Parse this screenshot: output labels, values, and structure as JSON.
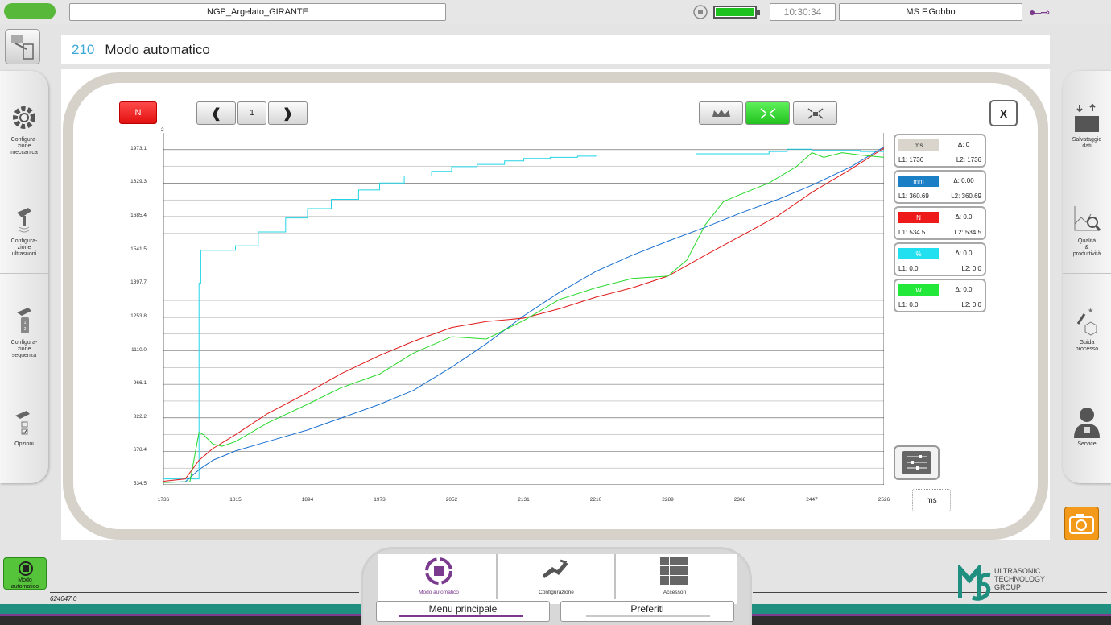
{
  "topbar": {
    "program_name": "NGP_Argelato_GIRANTE",
    "time": "10:30:34",
    "user": "MS F.Gobbo"
  },
  "header": {
    "number": "210",
    "title": "Modo automatico"
  },
  "left_nav": [
    {
      "label": "Configura-\nzione\nmeccanica",
      "icon": "gear-icon"
    },
    {
      "label": "Configura-\nzione\nultrasuoni",
      "icon": "sonotrode-icon"
    },
    {
      "label": "Configura-\nzione\nsequenza",
      "icon": "sequence-icon"
    },
    {
      "label": "Opzioni",
      "icon": "options-icon"
    }
  ],
  "right_nav": [
    {
      "label": "Salvataggio\ndati",
      "icon": "save-data-icon"
    },
    {
      "label": "Qualità\n&\nproduttività",
      "icon": "quality-icon"
    },
    {
      "label": "Guida\nprocesso",
      "icon": "process-guide-icon"
    },
    {
      "label": "Service",
      "icon": "service-person-icon"
    }
  ],
  "chart_controls": {
    "unit_button": "N",
    "page": "1",
    "close": "X"
  },
  "legend": [
    {
      "unit": "ms",
      "delta": "Δ: 0",
      "l1": "L1: 1736",
      "l2": "L2: 1736",
      "color": "#d9d4cc"
    },
    {
      "unit": "mm",
      "delta": "Δ: 0.00",
      "l1": "L1: 360.69",
      "l2": "L2: 360.69",
      "color": "#1a7fc4"
    },
    {
      "unit": "N",
      "delta": "Δ: 0.0",
      "l1": "L1: 534.5",
      "l2": "L2: 534.5",
      "color": "#ee1a1a"
    },
    {
      "unit": "%",
      "delta": "Δ: 0.0",
      "l1": "L1: 0.0",
      "l2": "L2: 0.0",
      "color": "#22e0f0"
    },
    {
      "unit": "W",
      "delta": "Δ: 0.0",
      "l1": "L1: 0.0",
      "l2": "L2: 0.0",
      "color": "#22e83a"
    }
  ],
  "x_unit": "ms",
  "chart_data": {
    "type": "line",
    "y_top_marker": "2",
    "yticks": [
      "1973.1",
      "1829.3",
      "1685.4",
      "1541.5",
      "1397.7",
      "1253.8",
      "1110.0",
      "966.1",
      "822.2",
      "678.4",
      "534.5"
    ],
    "xticks": [
      "1736",
      "1815",
      "1894",
      "1973",
      "2052",
      "2131",
      "2210",
      "2289",
      "2368",
      "2447",
      "2526"
    ],
    "xlim": [
      1736,
      2526
    ],
    "ylim": [
      534.5,
      2045
    ],
    "series": [
      {
        "name": "%",
        "color": "#22d4e6",
        "x": [
          1736,
          1760,
          1772,
          1775,
          1777,
          1780,
          1800,
          1815,
          1840,
          1870,
          1894,
          1920,
          1950,
          1973,
          2000,
          2030,
          2052,
          2080,
          2110,
          2131,
          2160,
          2190,
          2210,
          2240,
          2289,
          2320,
          2368,
          2400,
          2420,
          2447,
          2470,
          2500,
          2526
        ],
        "y": [
          560,
          560,
          560,
          1400,
          1541,
          1541,
          1541,
          1560,
          1620,
          1680,
          1720,
          1760,
          1800,
          1830,
          1860,
          1880,
          1900,
          1910,
          1925,
          1935,
          1940,
          1945,
          1950,
          1950,
          1950,
          1955,
          1955,
          1965,
          1975,
          1970,
          1970,
          1965,
          1960
        ]
      },
      {
        "name": "mm",
        "color": "#1a6fd0",
        "x": [
          1736,
          1760,
          1775,
          1790,
          1815,
          1850,
          1894,
          1930,
          1973,
          2010,
          2052,
          2090,
          2131,
          2170,
          2210,
          2250,
          2289,
          2330,
          2368,
          2410,
          2447,
          2490,
          2526
        ],
        "y": [
          545,
          548,
          600,
          640,
          680,
          720,
          770,
          820,
          880,
          940,
          1040,
          1140,
          1260,
          1360,
          1450,
          1520,
          1580,
          1640,
          1700,
          1760,
          1820,
          1900,
          1985
        ]
      },
      {
        "name": "N",
        "color": "#e01818",
        "x": [
          1736,
          1760,
          1775,
          1790,
          1815,
          1850,
          1894,
          1930,
          1973,
          2010,
          2052,
          2090,
          2131,
          2170,
          2210,
          2250,
          2289,
          2330,
          2368,
          2410,
          2447,
          2490,
          2526
        ],
        "y": [
          550,
          560,
          640,
          690,
          750,
          840,
          930,
          1010,
          1090,
          1150,
          1210,
          1235,
          1250,
          1290,
          1340,
          1380,
          1430,
          1520,
          1600,
          1690,
          1790,
          1890,
          1980
        ]
      },
      {
        "name": "W",
        "color": "#26d82a",
        "x": [
          1736,
          1765,
          1775,
          1780,
          1790,
          1800,
          1815,
          1850,
          1894,
          1930,
          1973,
          2010,
          2052,
          2090,
          2131,
          2170,
          2210,
          2250,
          2289,
          2310,
          2330,
          2350,
          2368,
          2400,
          2430,
          2447,
          2460,
          2480,
          2500,
          2526
        ],
        "y": [
          545,
          548,
          760,
          750,
          710,
          700,
          720,
          800,
          880,
          950,
          1010,
          1100,
          1170,
          1160,
          1240,
          1330,
          1380,
          1420,
          1430,
          1500,
          1650,
          1750,
          1780,
          1830,
          1900,
          1960,
          1940,
          1960,
          1950,
          1940
        ]
      }
    ]
  },
  "bottom": {
    "auto_mode_label": "Modo\nautomatico",
    "code": "624047.0",
    "dock": [
      {
        "label": "Modo automatico",
        "icon": "auto-mode-icon",
        "color": "#7a3b8e"
      },
      {
        "label": "Configurazione",
        "icon": "configuration-icon",
        "color": "#333"
      },
      {
        "label": "Accessori",
        "icon": "accessories-grid-icon",
        "color": "#333"
      }
    ],
    "tab_main": "Menu principale",
    "tab_favorites": "Preferiti",
    "logo_text": [
      "ULTRASONIC",
      "TECHNOLOGY",
      "GROUP"
    ]
  }
}
